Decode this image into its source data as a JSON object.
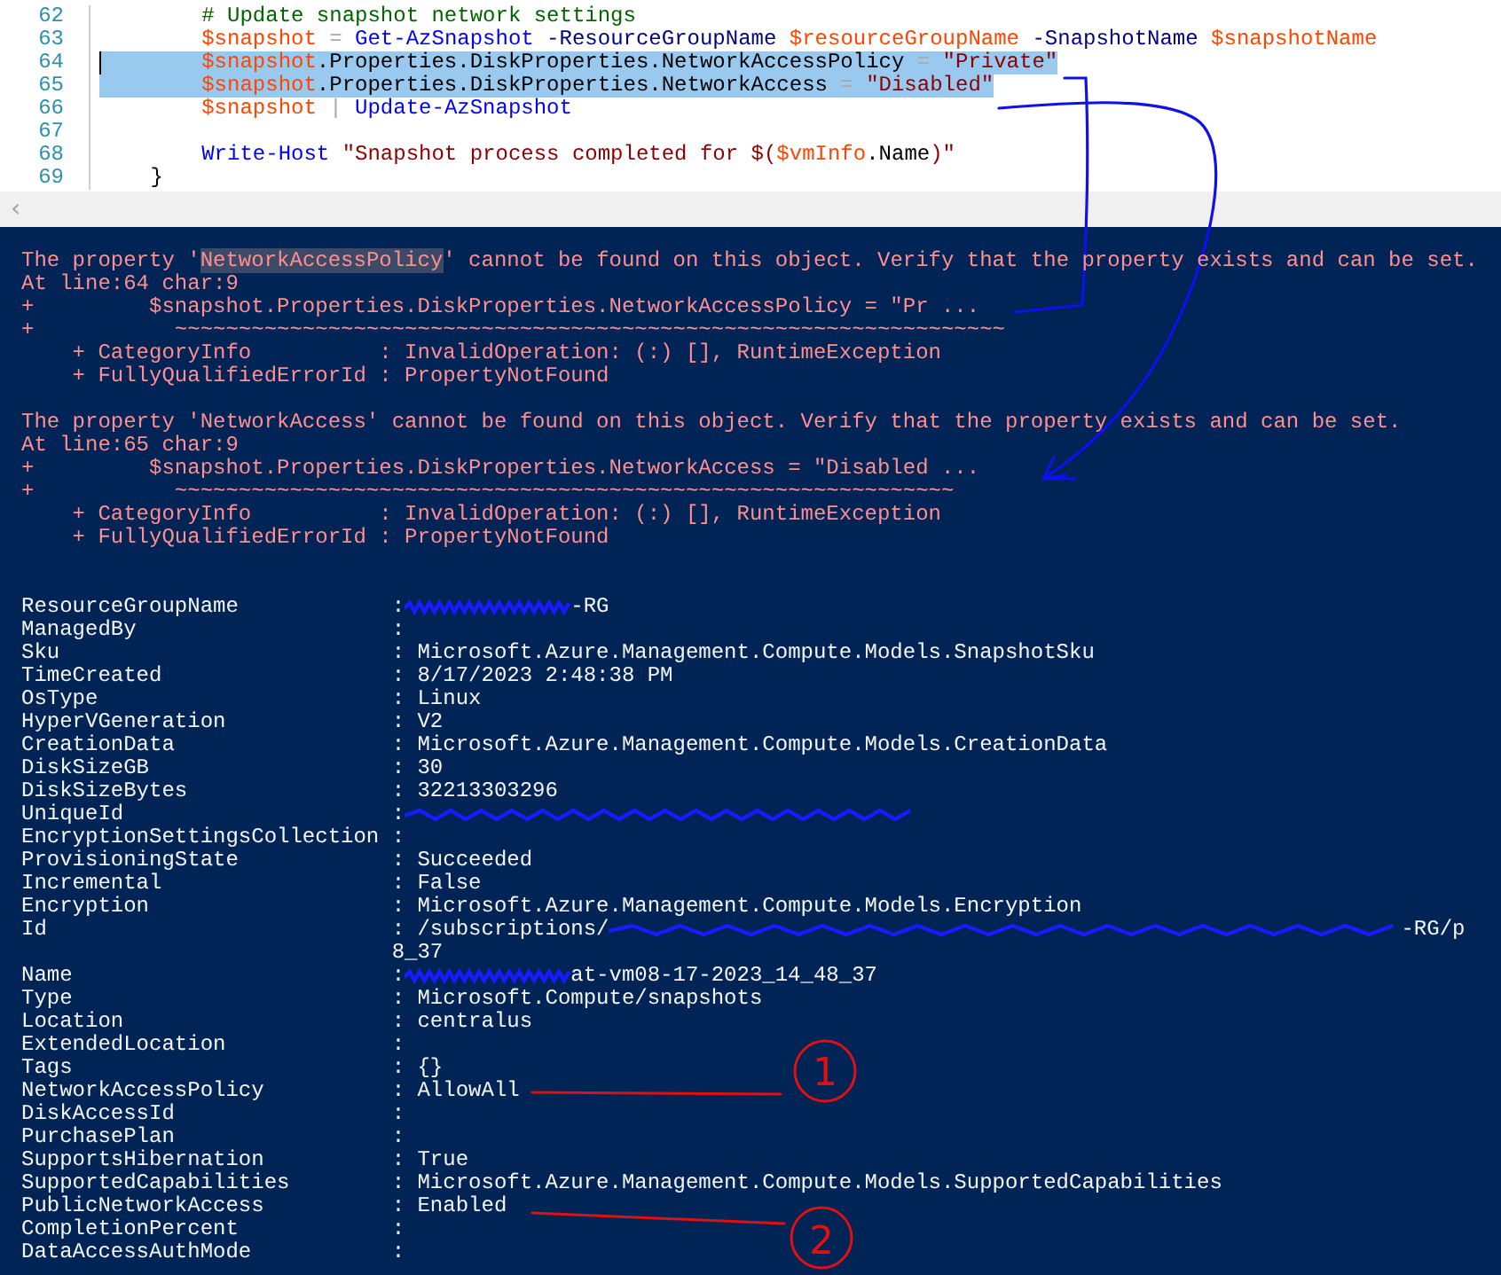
{
  "editor": {
    "lines": [
      {
        "number": "62",
        "selected": false,
        "tokens": [
          {
            "kind": "comment",
            "text": "        # Update snapshot network settings"
          }
        ]
      },
      {
        "number": "63",
        "selected": false,
        "tokens": [
          {
            "kind": "variable",
            "text": "        $snapshot"
          },
          {
            "kind": "operator",
            "text": " = "
          },
          {
            "kind": "command",
            "text": "Get-AzSnapshot"
          },
          {
            "kind": "parameter",
            "text": " -ResourceGroupName "
          },
          {
            "kind": "variable",
            "text": "$resourceGroupName"
          },
          {
            "kind": "parameter",
            "text": " -SnapshotName "
          },
          {
            "kind": "variable",
            "text": "$snapshotName"
          }
        ]
      },
      {
        "number": "64",
        "selected": true,
        "caret": true,
        "tokens": [
          {
            "kind": "variable",
            "text": "        $snapshot"
          },
          {
            "kind": "member",
            "text": ".Properties.DiskProperties.NetworkAccessPolicy"
          },
          {
            "kind": "operator",
            "text": " = "
          },
          {
            "kind": "string",
            "text": "\"Private\""
          }
        ]
      },
      {
        "number": "65",
        "selected": true,
        "tokens": [
          {
            "kind": "variable",
            "text": "        $snapshot"
          },
          {
            "kind": "member",
            "text": ".Properties.DiskProperties.NetworkAccess"
          },
          {
            "kind": "operator",
            "text": " = "
          },
          {
            "kind": "string",
            "text": "\"Disabled\""
          }
        ]
      },
      {
        "number": "66",
        "selected": false,
        "tokens": [
          {
            "kind": "variable",
            "text": "        $snapshot"
          },
          {
            "kind": "operator",
            "text": " | "
          },
          {
            "kind": "command",
            "text": "Update-AzSnapshot"
          }
        ]
      },
      {
        "number": "67",
        "selected": false
      },
      {
        "number": "68",
        "selected": false,
        "tokens": [
          {
            "kind": "command",
            "text": "        Write-Host"
          },
          {
            "kind": "string",
            "text": " \"Snapshot process completed for $("
          },
          {
            "kind": "variable",
            "text": "$vmInfo"
          },
          {
            "kind": "member",
            "text": ".Name"
          },
          {
            "kind": "string",
            "text": ")\""
          }
        ]
      },
      {
        "number": "69",
        "selected": false,
        "tokens": [
          {
            "kind": "member",
            "text": "    }"
          }
        ]
      }
    ],
    "scroll_arrow": "‹"
  },
  "errors": [
    {
      "message": [
        {
          "text": "The property '",
          "highlighted": false
        },
        {
          "text": "NetworkAccessPolicy",
          "highlighted": true
        },
        {
          "text": "' cannot be found on this object. Verify that the property exists and can be set.",
          "highlighted": false
        }
      ],
      "location": "At line:64 char:9",
      "code": "+         $snapshot.Properties.DiskProperties.NetworkAccessPolicy = \"Pr ...",
      "squiggle": "+           ~~~~~~~~~~~~~~~~~~~~~~~~~~~~~~~~~~~~~~~~~~~~~~~~~~~~~~~~~~~~~~~~~",
      "category": "    + CategoryInfo          : InvalidOperation: (:) [], RuntimeException",
      "error_id": "    + FullyQualifiedErrorId : PropertyNotFound"
    },
    {
      "message": [
        {
          "text": "The property 'NetworkAccess' cannot be found on this object. Verify that the property exists and can be set.",
          "highlighted": false
        }
      ],
      "location": "At line:65 char:9",
      "code": "+         $snapshot.Properties.DiskProperties.NetworkAccess = \"Disabled ...",
      "squiggle": "+           ~~~~~~~~~~~~~~~~~~~~~~~~~~~~~~~~~~~~~~~~~~~~~~~~~~~~~~~~~~~~~",
      "category": "    + CategoryInfo          : InvalidOperation: (:) [], RuntimeException",
      "error_id": "    + FullyQualifiedErrorId : PropertyNotFound"
    }
  ],
  "properties": [
    {
      "name": "ResourceGroupName",
      "value": ":",
      "redacted": true,
      "after": "-RG"
    },
    {
      "name": "ManagedBy",
      "value": ":"
    },
    {
      "name": "Sku",
      "value": ": Microsoft.Azure.Management.Compute.Models.SnapshotSku"
    },
    {
      "name": "TimeCreated",
      "value": ": 8/17/2023 2:48:38 PM"
    },
    {
      "name": "OsType",
      "value": ": Linux"
    },
    {
      "name": "HyperVGeneration",
      "value": ": V2"
    },
    {
      "name": "CreationData",
      "value": ": Microsoft.Azure.Management.Compute.Models.CreationData"
    },
    {
      "name": "DiskSizeGB",
      "value": ": 30"
    },
    {
      "name": "DiskSizeBytes",
      "value": ": 32213303296"
    },
    {
      "name": "UniqueId",
      "value": ":",
      "redacted": true
    },
    {
      "name": "EncryptionSettingsCollection",
      "value": ":"
    },
    {
      "name": "ProvisioningState",
      "value": ": Succeeded"
    },
    {
      "name": "Incremental",
      "value": ": False"
    },
    {
      "name": "Encryption",
      "value": ": Microsoft.Azure.Management.Compute.Models.Encryption"
    },
    {
      "name": "Id",
      "value": ": /subscriptions/",
      "redacted": true,
      "after": "-RG/p",
      "continuation": "8_37"
    },
    {
      "name": "Name",
      "value": ":",
      "redacted": true,
      "after": "at-vm08-17-2023_14_48_37"
    },
    {
      "name": "Type",
      "value": ": Microsoft.Compute/snapshots"
    },
    {
      "name": "Location",
      "value": ": centralus"
    },
    {
      "name": "ExtendedLocation",
      "value": ":"
    },
    {
      "name": "Tags",
      "value": ": {}"
    },
    {
      "name": "NetworkAccessPolicy",
      "value": ": AllowAll"
    },
    {
      "name": "DiskAccessId",
      "value": ":"
    },
    {
      "name": "PurchasePlan",
      "value": ":"
    },
    {
      "name": "SupportsHibernation",
      "value": ": True"
    },
    {
      "name": "SupportedCapabilities",
      "value": ": Microsoft.Azure.Management.Compute.Models.SupportedCapabilities"
    },
    {
      "name": "PublicNetworkAccess",
      "value": ": Enabled"
    },
    {
      "name": "CompletionPercent",
      "value": ":"
    },
    {
      "name": "DataAccessAuthMode",
      "value": ":"
    }
  ],
  "annotations": [
    {
      "kind": "bracket-arrow"
    },
    {
      "kind": "arrow"
    },
    {
      "kind": "numbered-underline",
      "label": "1"
    },
    {
      "kind": "numbered-underline",
      "label": "2"
    }
  ]
}
